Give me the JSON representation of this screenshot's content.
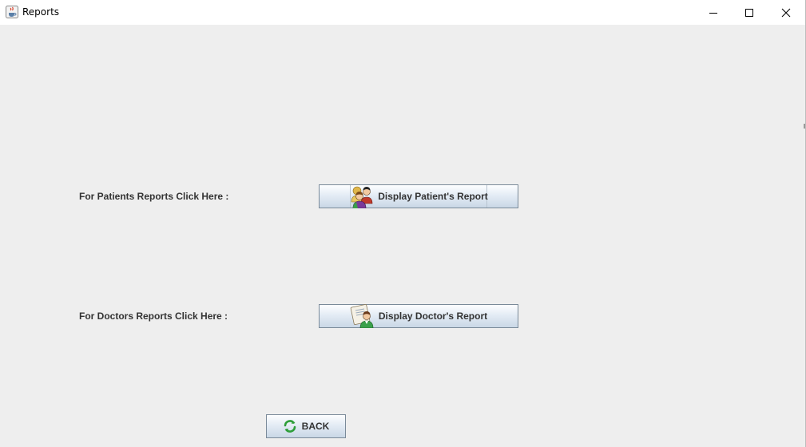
{
  "window": {
    "title": "Reports",
    "app_icon": "java-cup-icon",
    "controls": {
      "minimize_icon": "minimize-icon",
      "maximize_icon": "maximize-icon",
      "close_icon": "close-icon"
    }
  },
  "patients": {
    "label": "For Patients Reports Click Here :",
    "button_label": "Display Patient's Report",
    "button_icon": "patients-group-icon"
  },
  "doctors": {
    "label": "For Doctors Reports Click Here :",
    "button_label": "Display Doctor's Report",
    "button_icon": "doctor-clipboard-icon"
  },
  "back": {
    "label": "BACK",
    "icon": "refresh-arrows-icon"
  },
  "colors": {
    "background": "#eeeeee",
    "titlebar": "#ffffff",
    "label_text": "#333333",
    "button_border": "#7a8a99",
    "back_icon_green": "#2e9e3a"
  }
}
